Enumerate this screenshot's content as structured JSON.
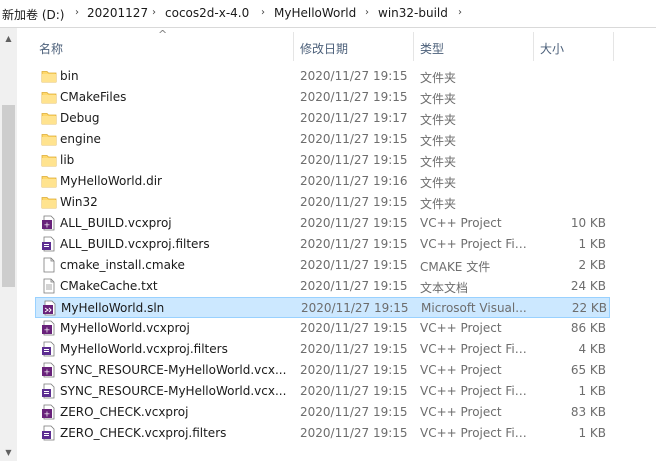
{
  "address": {
    "crumbs": [
      "新加卷 (D:)",
      "20201127",
      "cocos2d-x-4.0",
      "MyHelloWorld",
      "win32-build"
    ],
    "separator": "›"
  },
  "columns": {
    "name": "名称",
    "date": "修改日期",
    "type": "类型",
    "size": "大小",
    "sort_indicator": "^"
  },
  "files": [
    {
      "name": "bin",
      "date": "2020/11/27 19:15",
      "type": "文件夹",
      "size": "",
      "icon": "folder-icon"
    },
    {
      "name": "CMakeFiles",
      "date": "2020/11/27 19:15",
      "type": "文件夹",
      "size": "",
      "icon": "folder-icon"
    },
    {
      "name": "Debug",
      "date": "2020/11/27 19:17",
      "type": "文件夹",
      "size": "",
      "icon": "folder-icon"
    },
    {
      "name": "engine",
      "date": "2020/11/27 19:15",
      "type": "文件夹",
      "size": "",
      "icon": "folder-icon"
    },
    {
      "name": "lib",
      "date": "2020/11/27 19:15",
      "type": "文件夹",
      "size": "",
      "icon": "folder-icon"
    },
    {
      "name": "MyHelloWorld.dir",
      "date": "2020/11/27 19:16",
      "type": "文件夹",
      "size": "",
      "icon": "folder-icon"
    },
    {
      "name": "Win32",
      "date": "2020/11/27 19:15",
      "type": "文件夹",
      "size": "",
      "icon": "folder-icon"
    },
    {
      "name": "ALL_BUILD.vcxproj",
      "date": "2020/11/27 19:15",
      "type": "VC++ Project",
      "size": "10 KB",
      "icon": "vcxproj-icon"
    },
    {
      "name": "ALL_BUILD.vcxproj.filters",
      "date": "2020/11/27 19:15",
      "type": "VC++ Project Fil...",
      "size": "1 KB",
      "icon": "filters-icon"
    },
    {
      "name": "cmake_install.cmake",
      "date": "2020/11/27 19:15",
      "type": "CMAKE 文件",
      "size": "2 KB",
      "icon": "blank-file-icon"
    },
    {
      "name": "CMakeCache.txt",
      "date": "2020/11/27 19:15",
      "type": "文本文档",
      "size": "24 KB",
      "icon": "text-file-icon"
    },
    {
      "name": "MyHelloWorld.sln",
      "date": "2020/11/27 19:15",
      "type": "Microsoft Visual...",
      "size": "22 KB",
      "icon": "sln-icon",
      "selected": true
    },
    {
      "name": "MyHelloWorld.vcxproj",
      "date": "2020/11/27 19:15",
      "type": "VC++ Project",
      "size": "86 KB",
      "icon": "vcxproj-icon"
    },
    {
      "name": "MyHelloWorld.vcxproj.filters",
      "date": "2020/11/27 19:15",
      "type": "VC++ Project Fil...",
      "size": "4 KB",
      "icon": "filters-icon"
    },
    {
      "name": "SYNC_RESOURCE-MyHelloWorld.vcx...",
      "date": "2020/11/27 19:15",
      "type": "VC++ Project",
      "size": "65 KB",
      "icon": "vcxproj-icon"
    },
    {
      "name": "SYNC_RESOURCE-MyHelloWorld.vcx...",
      "date": "2020/11/27 19:15",
      "type": "VC++ Project Fil...",
      "size": "1 KB",
      "icon": "filters-icon"
    },
    {
      "name": "ZERO_CHECK.vcxproj",
      "date": "2020/11/27 19:15",
      "type": "VC++ Project",
      "size": "83 KB",
      "icon": "vcxproj-icon"
    },
    {
      "name": "ZERO_CHECK.vcxproj.filters",
      "date": "2020/11/27 19:15",
      "type": "VC++ Project Fil...",
      "size": "1 KB",
      "icon": "filters-icon"
    }
  ],
  "colors": {
    "selection_bg": "#cce8ff",
    "selection_border": "#99d1ff",
    "folder": "#ffd86b",
    "header_text": "#4c607a"
  }
}
